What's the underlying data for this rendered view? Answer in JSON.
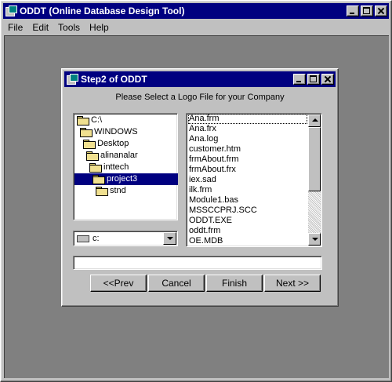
{
  "main_window": {
    "title": "ODDT (Online Database Design Tool)",
    "menu": [
      "File",
      "Edit",
      "Tools",
      "Help"
    ]
  },
  "dialog": {
    "title": "Step2 of ODDT",
    "instruction": "Please Select a Logo File for your Company",
    "folders": [
      "C:\\",
      "WINDOWS",
      "Desktop",
      "alinanalar",
      "inttech",
      "project3",
      "stnd"
    ],
    "selected_folder": "project3",
    "drive": "c:",
    "files": [
      "Ana.frm",
      "Ana.frx",
      "Ana.log",
      "customer.htm",
      "frmAbout.frm",
      "frmAbout.frx",
      "iex.sad",
      "ilk.frm",
      "Module1.bas",
      "MSSCCPRJ.SCC",
      "ODDT.EXE",
      "oddt.frm",
      "OE.MDB"
    ],
    "filename_value": "",
    "buttons": {
      "prev": "<<Prev",
      "cancel": "Cancel",
      "finish": "Finish",
      "next": "Next >>"
    }
  },
  "colors": {
    "titlebar": "#000080",
    "face": "#c0c0c0",
    "workspace": "#808080"
  }
}
